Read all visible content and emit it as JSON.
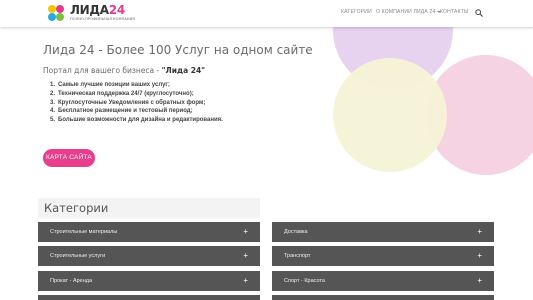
{
  "header": {
    "logo": {
      "main_text": "ЛИДА",
      "number": "24",
      "tagline": "ПОЛНО-ПРОФИЛЬНАЯ КОМПАНИЯ"
    },
    "nav": [
      {
        "label": "КАТЕГОРИИ"
      },
      {
        "label": "О КОМПАНИИ ЛИДА 24"
      },
      {
        "label": "КОНТАКТЫ"
      }
    ],
    "search_icon": "search-icon"
  },
  "hero": {
    "title": "Лида 24 - Более 100 Услуг на одном сайте",
    "subtitle_prefix": "Портал для вашего бизнеса - ",
    "subtitle_brand": "\"Лида 24\"",
    "features": [
      {
        "num": "1.",
        "text": "Самые лучшие позиции ваших услуг;"
      },
      {
        "num": "2.",
        "text": "Техническая поддержка 24/7 (круглосуточно);"
      },
      {
        "num": "3.",
        "text": "Круглосуточные Уведомления с обратных форм;"
      },
      {
        "num": "4.",
        "text": "Бесплатное размещение и тестовый период;"
      },
      {
        "num": "5.",
        "text": "Большие возможности для дизайна и редактирования."
      }
    ],
    "sitemap_button": "КАРТА САЙТА"
  },
  "categories": {
    "title": "Категории",
    "left": [
      {
        "label": "Строительные материалы",
        "toggle": "+"
      },
      {
        "label": "Строительные услуги",
        "toggle": "+"
      },
      {
        "label": "Прокат - Аренда",
        "toggle": "+"
      }
    ],
    "right": [
      {
        "label": "Доставка",
        "toggle": "+"
      },
      {
        "label": "Транспорт",
        "toggle": "+"
      },
      {
        "label": "Спорт - Красота",
        "toggle": "+"
      }
    ]
  },
  "colors": {
    "accent": "#e83e8c",
    "accordion_bg": "#555555",
    "circle_purple": "#e7d3f0",
    "circle_yellow": "#f6f3d6",
    "circle_pink": "#f6d3e2",
    "logo_yellow": "#f5c400",
    "logo_pink": "#e23b8f",
    "logo_blue": "#29a9e0",
    "logo_green": "#7bc043"
  }
}
